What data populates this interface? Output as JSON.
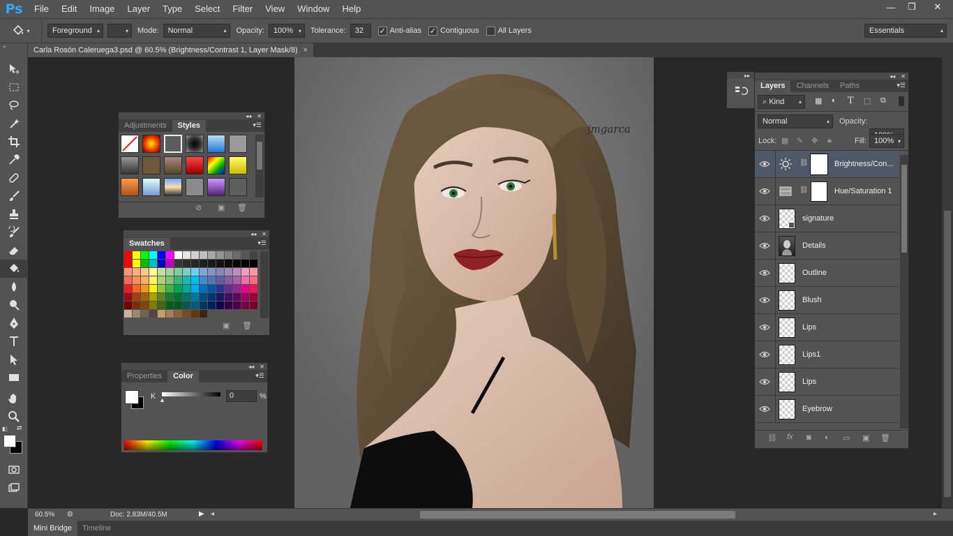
{
  "app": {
    "logo": "Ps"
  },
  "menu": [
    "File",
    "Edit",
    "Image",
    "Layer",
    "Type",
    "Select",
    "Filter",
    "View",
    "Window",
    "Help"
  ],
  "window_controls": {
    "minimize": "—",
    "restore": "❐",
    "close": "✕"
  },
  "options": {
    "fill_source": "Foreground",
    "mode_label": "Mode:",
    "mode_value": "Normal",
    "opacity_label": "Opacity:",
    "opacity_value": "100%",
    "tolerance_label": "Tolerance:",
    "tolerance_value": "32",
    "antialias_label": "Anti-alias",
    "contiguous_label": "Contiguous",
    "all_layers_label": "All Layers",
    "antialias_checked": true,
    "contiguous_checked": true,
    "all_layers_checked": false,
    "workspace": "Essentials"
  },
  "document": {
    "tab_title": "Carla Rosón Caleruega3.psd @ 60.5% (Brightness/Contrast 1, Layer Mask/8)",
    "close": "×",
    "signature_text": "jmgarca"
  },
  "styles_panel": {
    "tabs": [
      "Adjustments",
      "Styles"
    ],
    "active": "Styles"
  },
  "swatches_panel": {
    "tabs": [
      "Swatches"
    ],
    "active": "Swatches"
  },
  "color_panel": {
    "tabs": [
      "Properties",
      "Color"
    ],
    "active": "Color",
    "channel_label": "K",
    "channel_value": "0",
    "unit": "%"
  },
  "layers_panel": {
    "tabs": [
      "Layers",
      "Channels",
      "Paths"
    ],
    "active": "Layers",
    "filter_kind": "Kind",
    "blend_mode": "Normal",
    "opacity_label": "Opacity:",
    "opacity_value": "100%",
    "lock_label": "Lock:",
    "fill_label": "Fill:",
    "fill_value": "100%",
    "layers": [
      {
        "name": "Brightness/Con...",
        "type": "adjustment-brightness",
        "selected": true
      },
      {
        "name": "Hue/Saturation 1",
        "type": "adjustment-hue",
        "selected": false
      },
      {
        "name": "signature",
        "type": "smart",
        "selected": false
      },
      {
        "name": "Details",
        "type": "image",
        "selected": false
      },
      {
        "name": "Outline",
        "type": "pixel",
        "selected": false
      },
      {
        "name": "Blush",
        "type": "pixel",
        "selected": false
      },
      {
        "name": "Lips",
        "type": "pixel",
        "selected": false
      },
      {
        "name": "Lips1",
        "type": "pixel",
        "selected": false
      },
      {
        "name": "Lips",
        "type": "pixel",
        "selected": false
      },
      {
        "name": "Eyebrow",
        "type": "pixel",
        "selected": false
      }
    ]
  },
  "status": {
    "zoom": "60.5%",
    "doc_info": "Doc: 2.83M/40.5M"
  },
  "bottom_tabs": [
    "Mini Bridge",
    "Timeline"
  ],
  "colors": {
    "ui_bg": "#535353",
    "dark_bg": "#282828",
    "accent": "#31a8ff",
    "selected_layer": "#4f5866",
    "lips": "#8e2226",
    "hair": "#6b5a40",
    "skin": "#d9bcab"
  }
}
